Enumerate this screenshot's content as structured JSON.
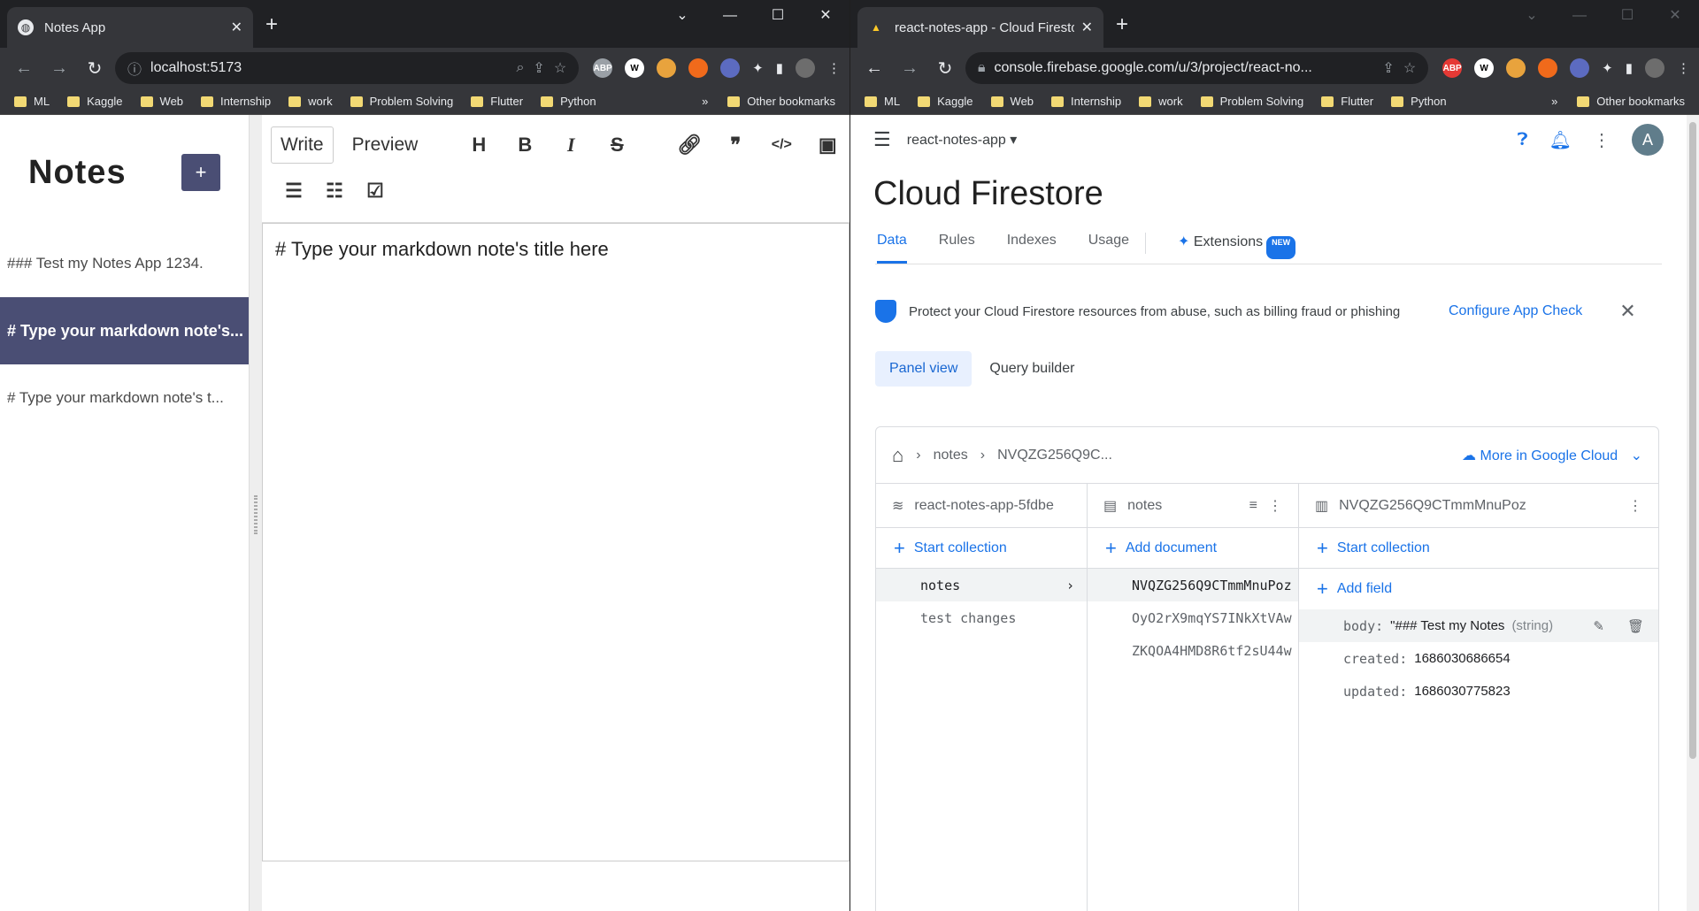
{
  "left": {
    "tab_title": "Notes App",
    "url": "localhost:5173",
    "bookmarks": [
      "ML",
      "Kaggle",
      "Web",
      "Internship",
      "work",
      "Problem Solving",
      "Flutter",
      "Python"
    ],
    "other_bookmarks": "Other bookmarks",
    "notes_title": "Notes",
    "add_label": "+",
    "notes": [
      "### Test my Notes App 1234.",
      "# Type your markdown note's...",
      "# Type your markdown note's t..."
    ],
    "selected_note_index": 1,
    "editor": {
      "write": "Write",
      "preview": "Preview",
      "content": "# Type your markdown note's title here"
    }
  },
  "right": {
    "tab_title": "react-notes-app - Cloud Firestore - F",
    "url": "console.firebase.google.com/u/3/project/react-no...",
    "bookmarks": [
      "ML",
      "Kaggle",
      "Web",
      "Internship",
      "work",
      "Problem Solving",
      "Flutter",
      "Python"
    ],
    "other_bookmarks": "Other bookmarks",
    "project": "react-notes-app",
    "avatar": "A",
    "title": "Cloud Firestore",
    "tabs": [
      "Data",
      "Rules",
      "Indexes",
      "Usage",
      "Extensions"
    ],
    "new_badge": "NEW",
    "banner": "Protect your Cloud Firestore resources from abuse, such as billing fraud or phishing",
    "banner_link": "Configure App Check",
    "panel_view": "Panel view",
    "query_builder": "Query builder",
    "crumbs": [
      "notes",
      "NVQZG256Q9C..."
    ],
    "more_cloud": "More in Google Cloud",
    "col1": {
      "header": "react-notes-app-5fdbe",
      "action": "Start collection",
      "rows": [
        "notes",
        "test changes"
      ]
    },
    "col2": {
      "header": "notes",
      "action": "Add document",
      "rows": [
        "NVQZG256Q9CTmmMnuPoz",
        "OyO2rX9mqYS7INkXtVAw",
        "ZKQOA4HMD8R6tf2sU44w"
      ]
    },
    "col3": {
      "header": "NVQZG256Q9CTmmMnuPoz",
      "action": "Start collection",
      "add_field": "Add field",
      "fields": [
        {
          "key": "body:",
          "value": "\"### Test my Notes",
          "type": "(string)"
        },
        {
          "key": "created:",
          "value": "1686030686654",
          "type": ""
        },
        {
          "key": "updated:",
          "value": "1686030775823",
          "type": ""
        }
      ]
    }
  }
}
